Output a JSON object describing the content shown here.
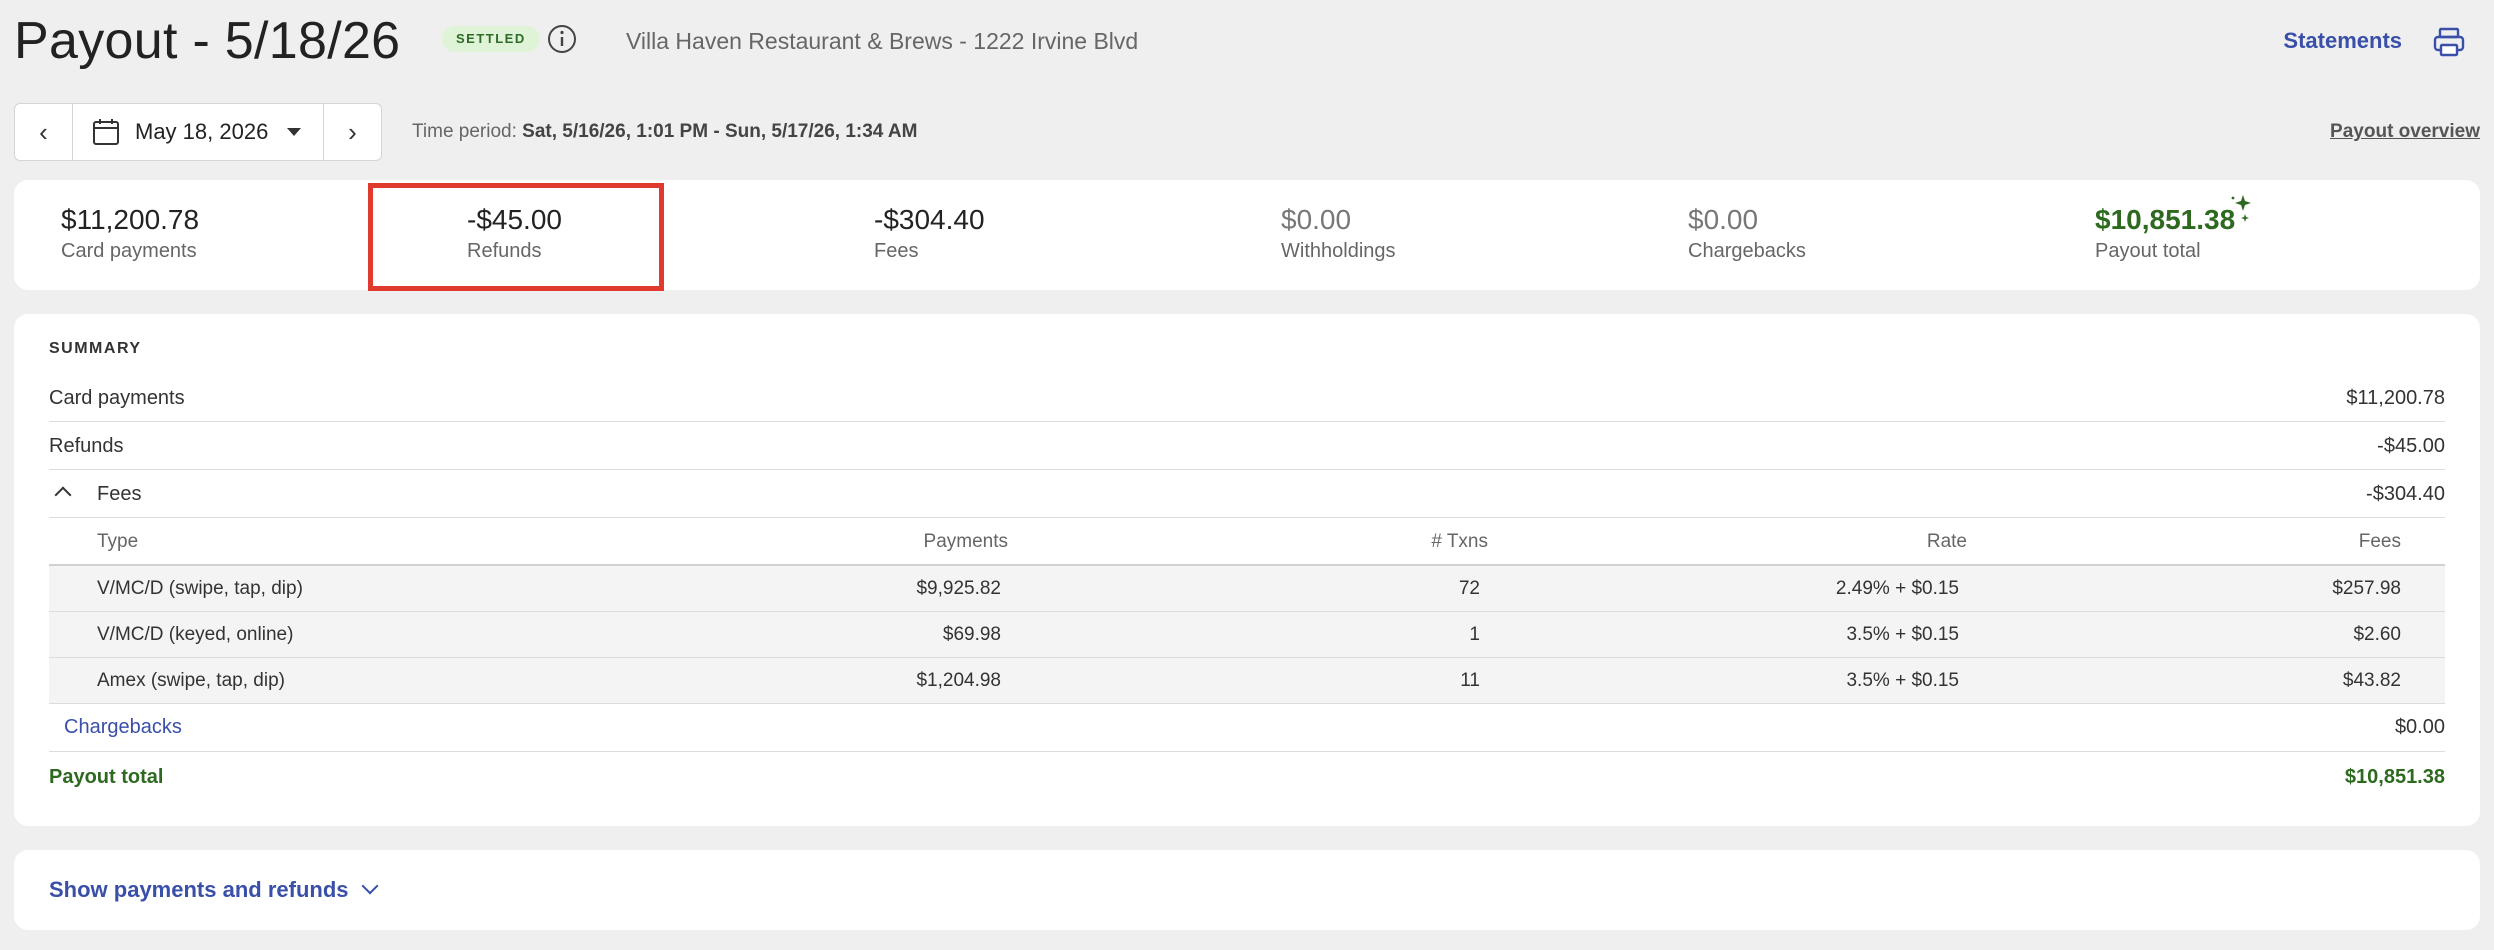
{
  "header": {
    "title": "Payout - 5/18/26",
    "status_badge": "SETTLED",
    "location": "Villa Haven Restaurant & Brews - 1222 Irvine Blvd",
    "statements_label": "Statements",
    "icons": [
      "info-icon",
      "print-icon"
    ]
  },
  "date_nav": {
    "date_label": "May 18, 2026",
    "time_period_label": "Time period:",
    "time_period_value": "Sat, 5/16/26, 1:01 PM - Sun, 5/17/26, 1:34 AM",
    "payout_overview_label": "Payout overview",
    "icons": [
      "chevron-left-icon",
      "calendar-icon",
      "caret-down-icon",
      "chevron-right-icon"
    ]
  },
  "totals": [
    {
      "amount": "$11,200.78",
      "label": "Card payments"
    },
    {
      "amount": "-$45.00",
      "label": "Refunds"
    },
    {
      "amount": "-$304.40",
      "label": "Fees"
    },
    {
      "amount": "$0.00",
      "label": "Withholdings"
    },
    {
      "amount": "$0.00",
      "label": "Chargebacks"
    },
    {
      "amount": "$10,851.38",
      "label": "Payout total"
    }
  ],
  "summary": {
    "title": "SUMMARY",
    "card_payments": {
      "label": "Card payments",
      "value": "$11,200.78"
    },
    "refunds": {
      "label": "Refunds",
      "value": "-$45.00"
    },
    "fees": {
      "label": "Fees",
      "value": "-$304.40"
    },
    "fee_table": {
      "headers": {
        "type": "Type",
        "payments": "Payments",
        "txns": "# Txns",
        "rate": "Rate",
        "fees": "Fees"
      },
      "rows": [
        {
          "type": "V/MC/D (swipe, tap, dip)",
          "payments": "$9,925.82",
          "txns": "72",
          "rate": "2.49% + $0.15",
          "fees": "$257.98"
        },
        {
          "type": "V/MC/D (keyed, online)",
          "payments": "$69.98",
          "txns": "1",
          "rate": "3.5% + $0.15",
          "fees": "$2.60"
        },
        {
          "type": "Amex (swipe, tap, dip)",
          "payments": "$1,204.98",
          "txns": "11",
          "rate": "3.5% + $0.15",
          "fees": "$43.82"
        }
      ]
    },
    "chargebacks": {
      "label": "Chargebacks",
      "value": "$0.00"
    },
    "payout_total": {
      "label": "Payout total",
      "value": "$10,851.38"
    }
  },
  "show_payments_label": "Show payments and refunds",
  "colors": {
    "accent": "#3a4fa8",
    "success": "#2d6a1f",
    "highlight": "#e03a2f",
    "badge_bg": "#dff3d6"
  }
}
